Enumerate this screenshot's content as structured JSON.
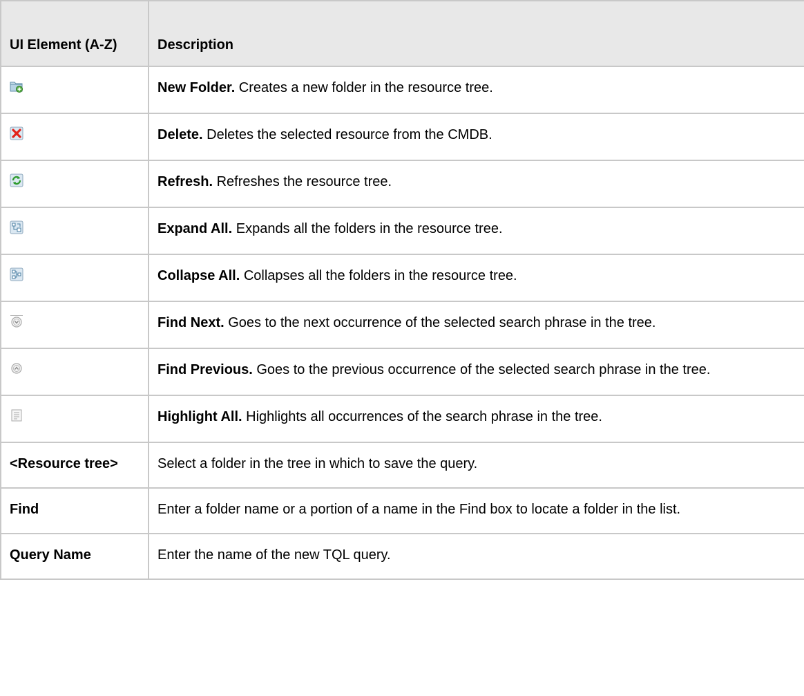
{
  "table": {
    "headers": [
      "UI Element (A-Z)",
      "Description"
    ],
    "rows": [
      {
        "icon": "new-folder-icon",
        "term": "New Folder.",
        "text": " Creates a new folder in the resource tree."
      },
      {
        "icon": "delete-icon",
        "term": "Delete.",
        "text": " Deletes the selected resource from the CMDB."
      },
      {
        "icon": "refresh-icon",
        "term": "Refresh.",
        "text": " Refreshes the resource tree."
      },
      {
        "icon": "expand-all-icon",
        "term": "Expand All.",
        "text": " Expands all the folders in the resource tree."
      },
      {
        "icon": "collapse-all-icon",
        "term": "Collapse All.",
        "text": " Collapses all the folders in the resource tree."
      },
      {
        "icon": "find-next-icon",
        "term": "Find Next.",
        "text": " Goes to the next occurrence of the selected search phrase in the tree."
      },
      {
        "icon": "find-previous-icon",
        "term": "Find Previous.",
        "text": " Goes to the previous occurrence of the selected search phrase in the tree."
      },
      {
        "icon": "highlight-all-icon",
        "term": "Highlight All.",
        "text": " Highlights all occurrences of the search phrase in the tree."
      },
      {
        "label": "<Resource tree>",
        "text": "Select a folder in the tree in which to save the query."
      },
      {
        "label": "Find",
        "text": "Enter a folder name or a portion of a name in the Find box to locate a folder in the list."
      },
      {
        "label": "Query Name",
        "text": "Enter the name of the new TQL query."
      }
    ]
  }
}
